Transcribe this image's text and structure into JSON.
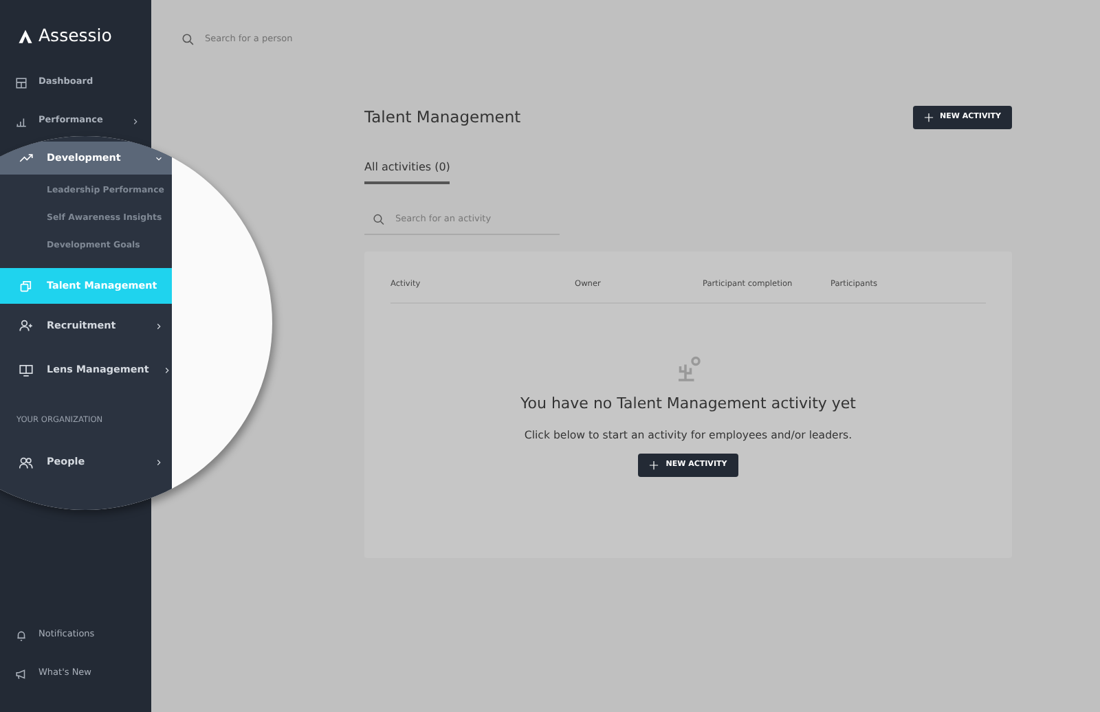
{
  "logo": {
    "text": "Assessio"
  },
  "top_search": {
    "placeholder": "Search for a person"
  },
  "sidebar": {
    "items": [
      {
        "label": "Dashboard",
        "expandable": false,
        "expanded": false,
        "selected": false
      },
      {
        "label": "Performance",
        "expandable": true,
        "expanded": false,
        "selected": false
      }
    ],
    "callout": {
      "items": [
        {
          "label": "Development",
          "expandable": true,
          "expanded": true,
          "selected": false,
          "children": [
            {
              "label": "Leadership Performance"
            },
            {
              "label": "Self Awareness Insights"
            },
            {
              "label": "Development Goals"
            }
          ]
        },
        {
          "label": "Talent Management",
          "expandable": false,
          "expanded": false,
          "selected": true
        },
        {
          "label": "Recruitment",
          "expandable": true,
          "expanded": false,
          "selected": false
        },
        {
          "label": "Lens Management",
          "expandable": true,
          "expanded": false,
          "selected": false
        }
      ],
      "section_label": "YOUR ORGANIZATION",
      "section_items": [
        {
          "label": "People",
          "expandable": true,
          "expanded": false,
          "selected": false
        }
      ]
    },
    "footer_items": [
      {
        "label": "Notifications"
      },
      {
        "label": "What's New"
      }
    ]
  },
  "page": {
    "title": "Talent Management",
    "new_button": "NEW ACTIVITY",
    "tabs": [
      {
        "label": "All activities (0)",
        "selected": true
      }
    ],
    "search": {
      "placeholder": "Search for an activity"
    },
    "table": {
      "columns": [
        "Activity",
        "Owner",
        "Participant completion",
        "Participants"
      ]
    },
    "empty": {
      "heading": "You have no Talent Management activity yet",
      "text": "Click below to start an activity for employees and/or leaders.",
      "button": "NEW ACTIVITY"
    }
  }
}
